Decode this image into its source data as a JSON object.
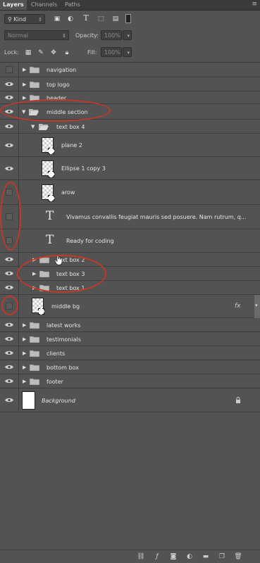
{
  "tabs": [
    "Layers",
    "Channels",
    "Paths"
  ],
  "filter": {
    "kind_label": "Kind"
  },
  "blend": {
    "mode": "Normal",
    "opacity_label": "Opacity:",
    "opacity_value": "100%"
  },
  "lock": {
    "label": "Lock:",
    "fill_label": "Fill:",
    "fill_value": "100%"
  },
  "layers": [
    {
      "name": "navigation",
      "type": "group",
      "visible": false
    },
    {
      "name": "top logo",
      "type": "group",
      "visible": true
    },
    {
      "name": "header",
      "type": "group",
      "visible": true
    },
    {
      "name": "middle section",
      "type": "group",
      "visible": true,
      "expanded": true
    },
    {
      "name": "text box 4",
      "type": "group",
      "visible": true,
      "expanded": true
    },
    {
      "name": "plane 2",
      "type": "shape",
      "visible": true
    },
    {
      "name": "Ellipse 1 copy 3",
      "type": "shape",
      "visible": true
    },
    {
      "name": "arow",
      "type": "shape",
      "visible": false
    },
    {
      "name": "Vivamus convallis feugiat mauris sed posuere. Nam rutrum, q...",
      "type": "text",
      "visible": false
    },
    {
      "name": "Ready for coding",
      "type": "text",
      "visible": false
    },
    {
      "name": "text box 2",
      "type": "group",
      "visible": true
    },
    {
      "name": "text box 3",
      "type": "group",
      "visible": true
    },
    {
      "name": "text box 1",
      "type": "group",
      "visible": true
    },
    {
      "name": "middle bg",
      "type": "shape",
      "visible": false,
      "fx": "fx"
    },
    {
      "name": "latest works",
      "type": "group",
      "visible": true
    },
    {
      "name": "testimonials",
      "type": "group",
      "visible": true
    },
    {
      "name": "clients",
      "type": "group",
      "visible": true
    },
    {
      "name": "bottom box",
      "type": "group",
      "visible": true
    },
    {
      "name": "footer",
      "type": "group",
      "visible": true
    },
    {
      "name": "Background",
      "type": "background",
      "visible": true,
      "locked": true
    }
  ],
  "text_glyph": "T",
  "colors": {
    "panel": "#535353",
    "annotation": "#c0392b",
    "tab_bar": "#3a3a3a"
  }
}
